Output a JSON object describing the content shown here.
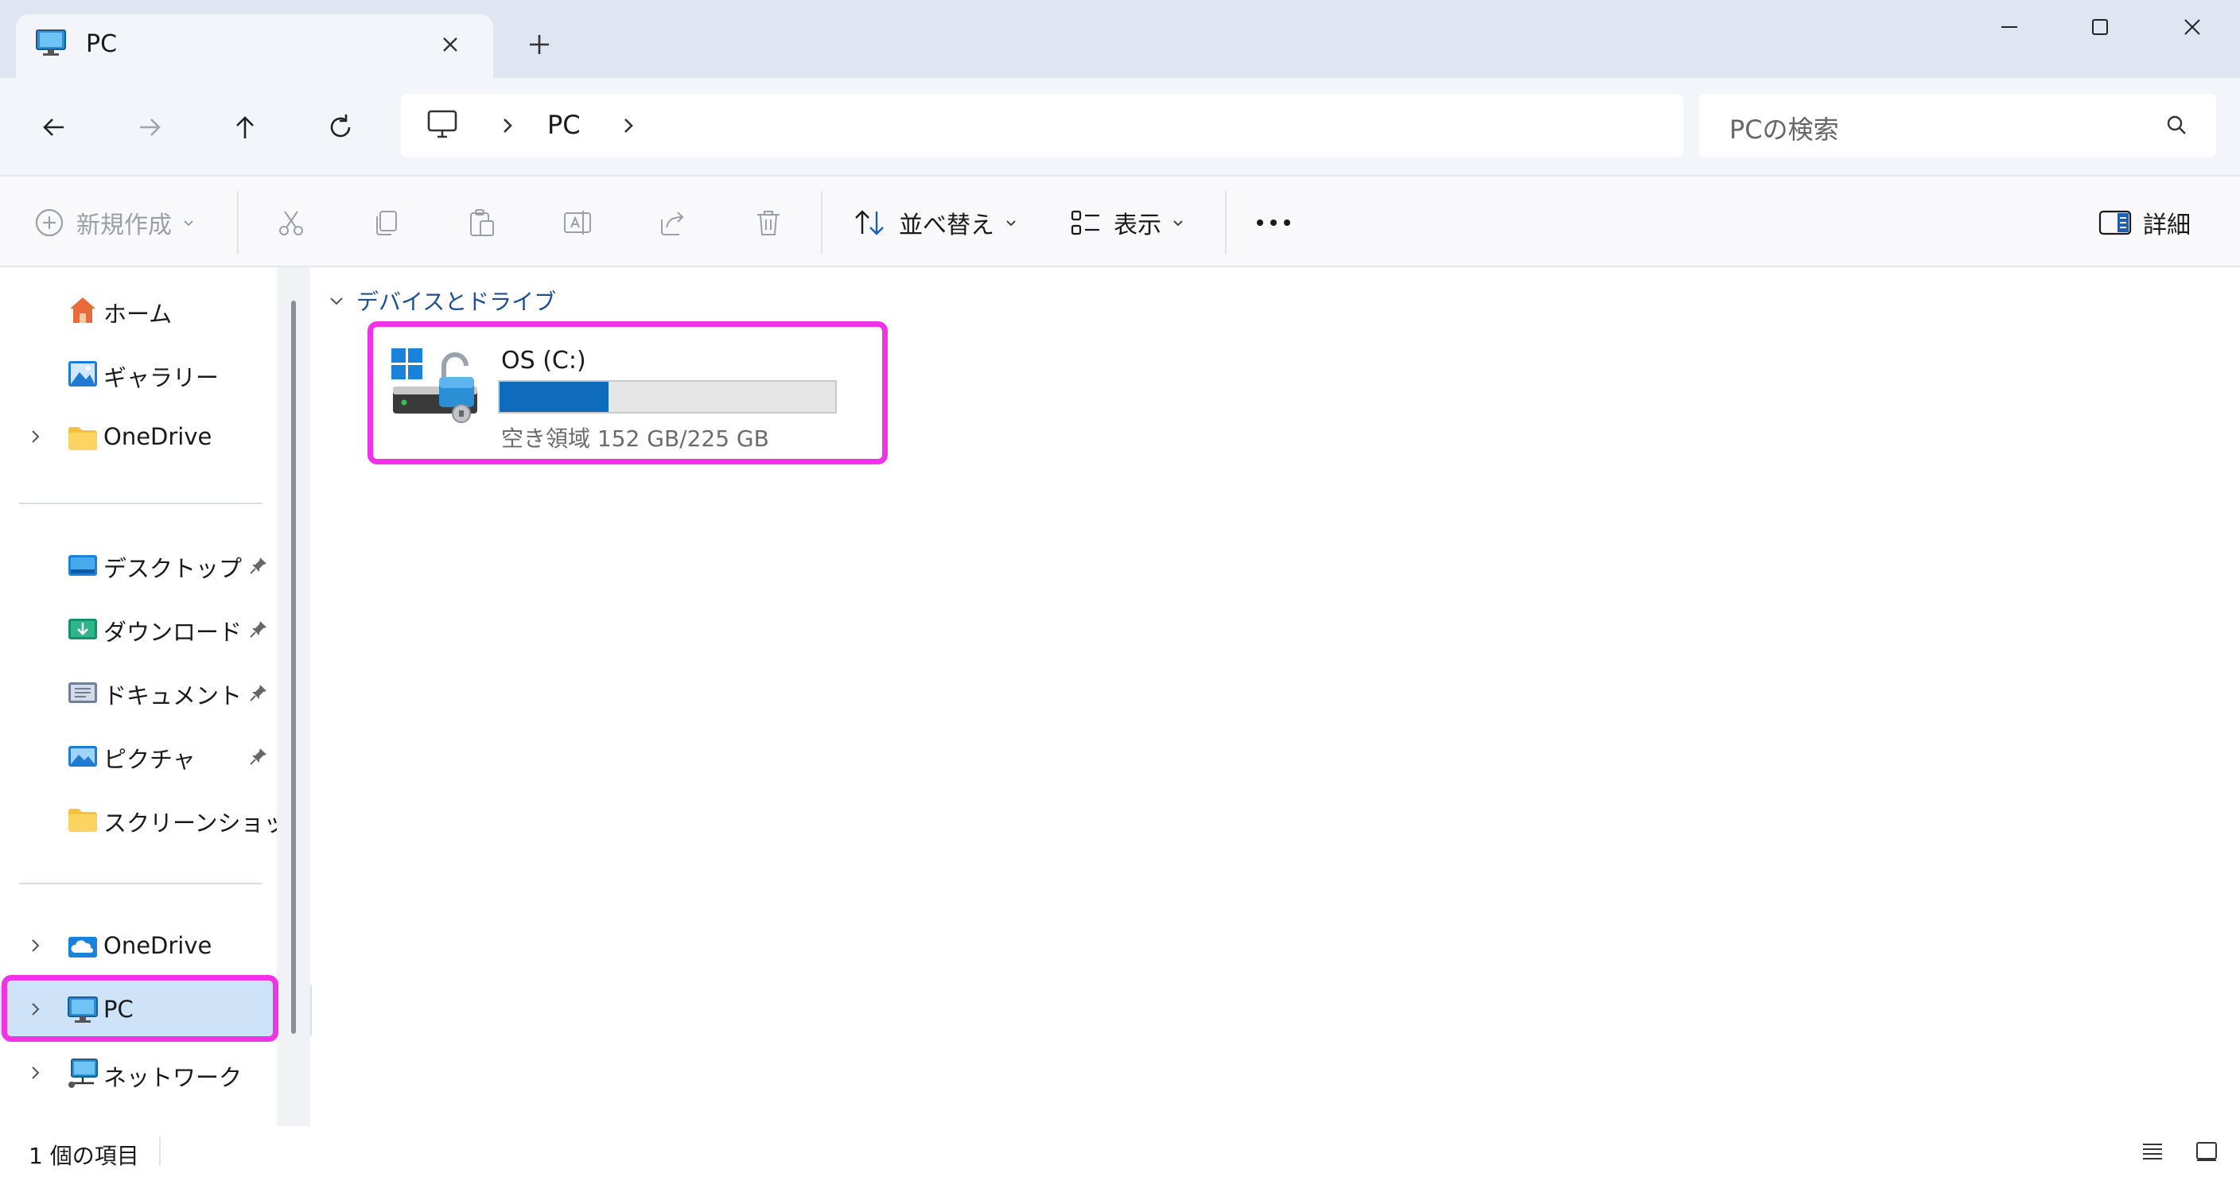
{
  "window": {
    "tab_title": "PC",
    "controls": {
      "minimize": "minimize-icon",
      "maximize": "maximize-icon",
      "close": "close-icon"
    }
  },
  "address_bar": {
    "crumbs": [
      "PC"
    ],
    "search_placeholder": "PCの検索"
  },
  "command_bar": {
    "new_label": "新規作成",
    "sort_label": "並べ替え",
    "view_label": "表示",
    "details_label": "詳細",
    "icons": [
      "cut-icon",
      "copy-icon",
      "paste-icon",
      "rename-icon",
      "share-icon",
      "delete-icon",
      "more-icon"
    ]
  },
  "sidebar": {
    "top_items": [
      {
        "label": "ホーム",
        "icon": "home-icon"
      },
      {
        "label": "ギャラリー",
        "icon": "gallery-icon"
      },
      {
        "label": "OneDrive",
        "icon": "folder-icon"
      }
    ],
    "quick_access": [
      {
        "label": "デスクトップ",
        "icon": "desktop-folder-icon",
        "pinned": true
      },
      {
        "label": "ダウンロード",
        "icon": "download-folder-icon",
        "pinned": true
      },
      {
        "label": "ドキュメント",
        "icon": "documents-folder-icon",
        "pinned": true
      },
      {
        "label": "ピクチャ",
        "icon": "pictures-folder-icon",
        "pinned": true
      },
      {
        "label": "スクリーンショット",
        "icon": "folder-icon",
        "pinned": false
      }
    ],
    "bottom_items": [
      {
        "label": "OneDrive",
        "icon": "onedrive-cloud-icon"
      },
      {
        "label": "PC",
        "icon": "pc-icon",
        "selected": true
      },
      {
        "label": "ネットワーク",
        "icon": "network-icon"
      }
    ]
  },
  "content": {
    "group_header": "デバイスとドライブ",
    "drives": [
      {
        "name": "OS (C:)",
        "free_text": "空き領域 152 GB/225 GB",
        "used_fraction": 0.3244
      }
    ]
  },
  "status_bar": {
    "item_count": "1 個の項目"
  },
  "colors": {
    "accent": "#0f6cbd",
    "highlight": "#f033e6",
    "selection": "#cfe3f8"
  }
}
